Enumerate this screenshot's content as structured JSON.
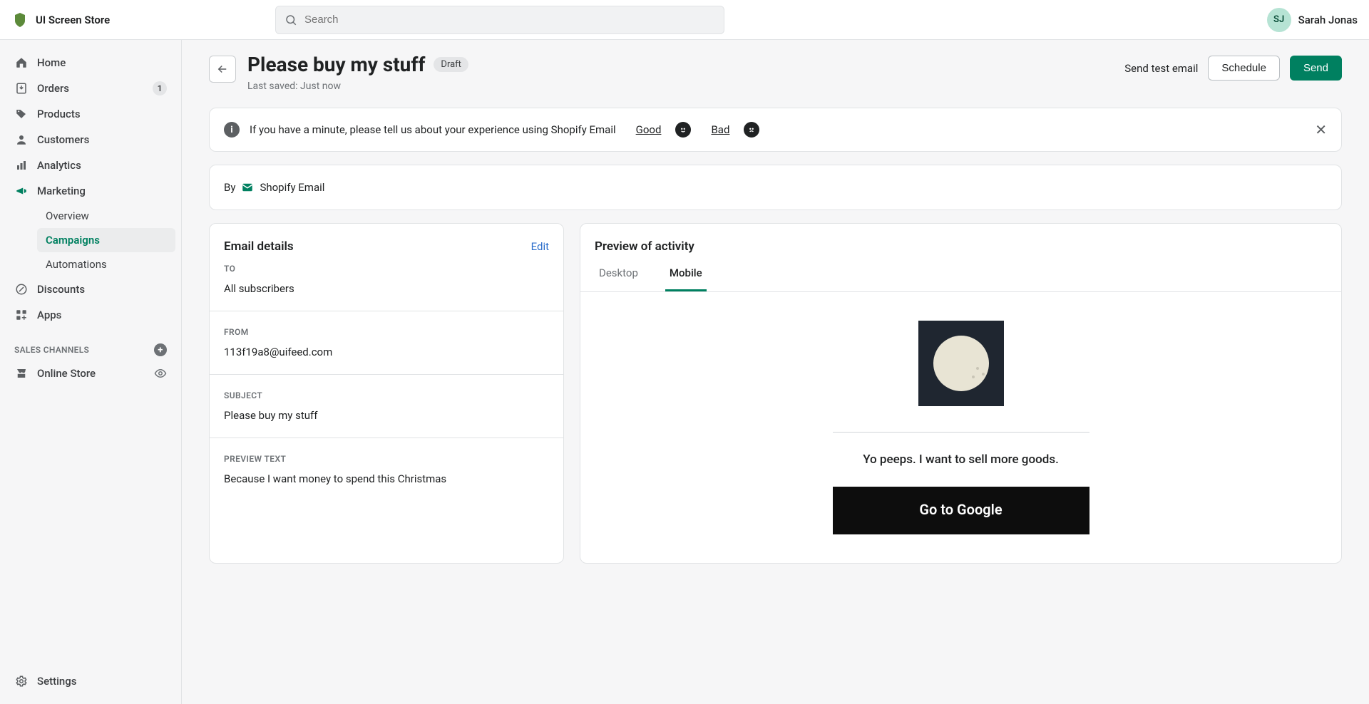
{
  "topbar": {
    "store_name": "UI Screen Store",
    "search_placeholder": "Search",
    "user_initials": "SJ",
    "user_name": "Sarah Jonas"
  },
  "sidebar": {
    "home": "Home",
    "orders": "Orders",
    "orders_count": "1",
    "products": "Products",
    "customers": "Customers",
    "analytics": "Analytics",
    "marketing": "Marketing",
    "overview": "Overview",
    "campaigns": "Campaigns",
    "automations": "Automations",
    "discounts": "Discounts",
    "apps": "Apps",
    "sales_channels": "SALES CHANNELS",
    "online_store": "Online Store",
    "settings": "Settings"
  },
  "page": {
    "title": "Please buy my stuff",
    "status": "Draft",
    "saved": "Last saved: Just now",
    "send_test": "Send test email",
    "schedule": "Schedule",
    "send": "Send"
  },
  "feedback": {
    "text": "If you have a minute, please tell us about your experience using Shopify Email",
    "good": "Good",
    "bad": "Bad"
  },
  "by_panel": {
    "by": "By",
    "app": "Shopify Email"
  },
  "details": {
    "heading": "Email details",
    "edit": "Edit",
    "to_label": "TO",
    "to_value": "All subscribers",
    "from_label": "FROM",
    "from_value": "113f19a8@uifeed.com",
    "subject_label": "SUBJECT",
    "subject_value": "Please buy my stuff",
    "preview_label": "PREVIEW TEXT",
    "preview_value": "Because I want money to spend this Christmas"
  },
  "preview": {
    "heading": "Preview of activity",
    "tab_desktop": "Desktop",
    "tab_mobile": "Mobile",
    "body_text": "Yo peeps. I want to sell more goods.",
    "cta": "Go to Google"
  }
}
